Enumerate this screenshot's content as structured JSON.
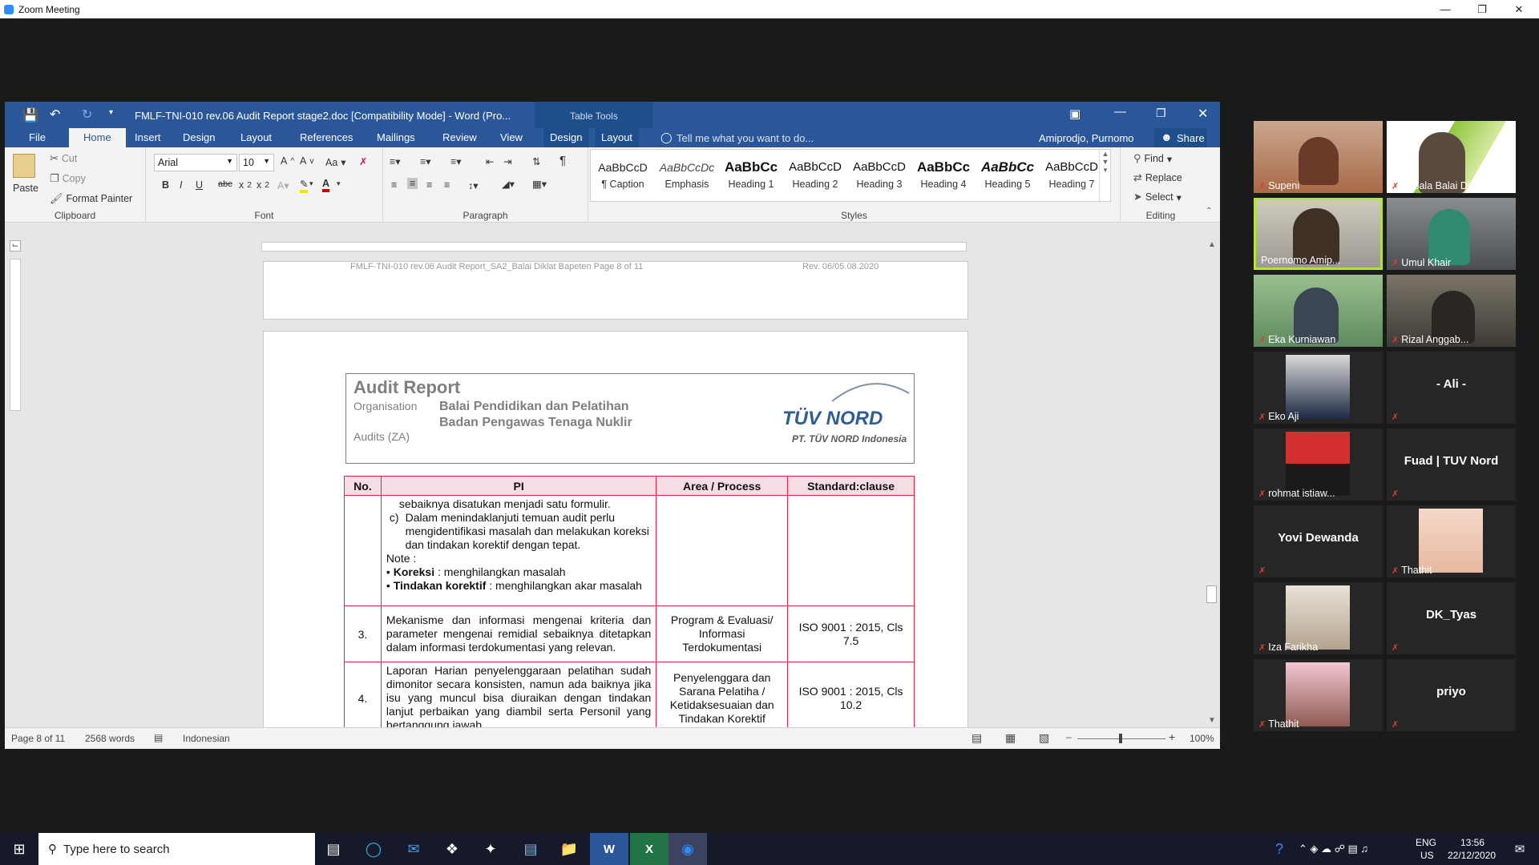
{
  "zoom": {
    "title": "Zoom Meeting"
  },
  "word": {
    "title": "FMLF-TNI-010 rev.06 Audit Report stage2.doc [Compatibility Mode] - Word (Pro...",
    "table_tools": "Table Tools",
    "user": "Amiprodjo, Purnomo",
    "share": "Share",
    "tell_me": "Tell me what you want to do...",
    "tabs": [
      "File",
      "Home",
      "Insert",
      "Design",
      "Layout",
      "References",
      "Mailings",
      "Review",
      "View",
      "Design",
      "Layout"
    ],
    "clipboard": {
      "paste": "Paste",
      "cut": "Cut",
      "copy": "Copy",
      "format_painter": "Format Painter",
      "label": "Clipboard"
    },
    "font": {
      "name": "Arial",
      "size": "10",
      "label": "Font",
      "aa": "Aa"
    },
    "paragraph": {
      "label": "Paragraph"
    },
    "styles": {
      "label": "Styles",
      "items": [
        {
          "preview": "AaBbCcD",
          "name": "¶ Caption"
        },
        {
          "preview": "AaBbCcDc",
          "name": "Emphasis"
        },
        {
          "preview": "AaBbCc",
          "name": "Heading 1"
        },
        {
          "preview": "AaBbCcD",
          "name": "Heading 2"
        },
        {
          "preview": "AaBbCcD",
          "name": "Heading 3"
        },
        {
          "preview": "AaBbCc",
          "name": "Heading 4"
        },
        {
          "preview": "AaBbCc",
          "name": "Heading 5"
        },
        {
          "preview": "AaBbCcD",
          "name": "Heading 7"
        }
      ]
    },
    "editing": {
      "find": "Find",
      "replace": "Replace",
      "select": "Select",
      "label": "Editing"
    },
    "prev_footer": "FMLF-TNI-010 rev.06 Audit Report_SA2_Balai Diklat Bapeten Page 8 of 11",
    "prev_footer_rev": "Rev. 06/05.08.2020",
    "report": {
      "title": "Audit Report",
      "org_label": "Organisation",
      "org_line1": "Balai Pendidikan dan Pelatihan",
      "org_line2": "Badan Pengawas Tenaga Nuklir",
      "audits": "Audits (ZA)",
      "logo": "TÜV NORD",
      "logo_sub": "PT. TÜV NORD Indonesia"
    },
    "table": {
      "headers": [
        "No.",
        "PI",
        "Area / Process",
        "Standard:clause"
      ],
      "row1": {
        "line0": "sebaiknya disatukan menjadi satu formulir.",
        "c_marker": "c)",
        "c_text": "Dalam menindaklanjuti temuan audit perlu mengidentifikasi masalah dan melakukan koreksi dan tindakan korektif dengan tepat.",
        "note": "Note :",
        "b1_bold": "Koreksi",
        "b1_rest": " : menghilangkan masalah",
        "b2_bold": "Tindakan korektif",
        "b2_rest": " : menghilangkan akar masalah"
      },
      "row2": {
        "no": "3.",
        "pi": "Mekanisme dan informasi mengenai kriteria dan parameter mengenai remidial sebaiknya ditetapkan dalam informasi terdokumentasi yang relevan.",
        "area": "Program & Evaluasi/ Informasi Terdokumentasi",
        "std": "ISO 9001 : 2015, Cls 7.5"
      },
      "row3": {
        "no": "4.",
        "pi": "Laporan Harian penyelenggaraan pelatihan sudah dimonitor secara konsisten, namun ada baiknya jika isu yang muncul bisa diuraikan dengan tindakan lanjut perbaikan yang diambil serta Personil yang bertanggung jawab.",
        "area": "Penyelenggara dan Sarana Pelatiha / Ketidaksesuaian dan Tindakan Korektif",
        "std": "ISO 9001 : 2015, Cls 10.2"
      }
    },
    "status": {
      "page": "Page 8 of 11",
      "words": "2568 words",
      "lang": "Indonesian",
      "zoom": "100%"
    }
  },
  "participants": [
    {
      "name": "Supeni"
    },
    {
      "name": "Kepala Balai Dikl..."
    },
    {
      "name": "Poernomo Amip..."
    },
    {
      "name": "Umul Khair"
    },
    {
      "name": "Eka Kurniawan"
    },
    {
      "name": "Rizal Anggab..."
    },
    {
      "name": "Eko Aji"
    },
    {
      "name": "- Ali -"
    },
    {
      "name": "rohmat istiaw..."
    },
    {
      "name": "Fuad | TUV Nord"
    },
    {
      "name": "Yovi Dewanda"
    },
    {
      "name": "Thathit"
    },
    {
      "name": "Iza Farikha"
    },
    {
      "name": "DK_Tyas"
    },
    {
      "name": "Thathit"
    },
    {
      "name": "priyo"
    }
  ],
  "taskbar": {
    "search": "Type here to search",
    "lang1": "ENG",
    "lang2": "US",
    "time": "13:56",
    "date": "22/12/2020"
  }
}
